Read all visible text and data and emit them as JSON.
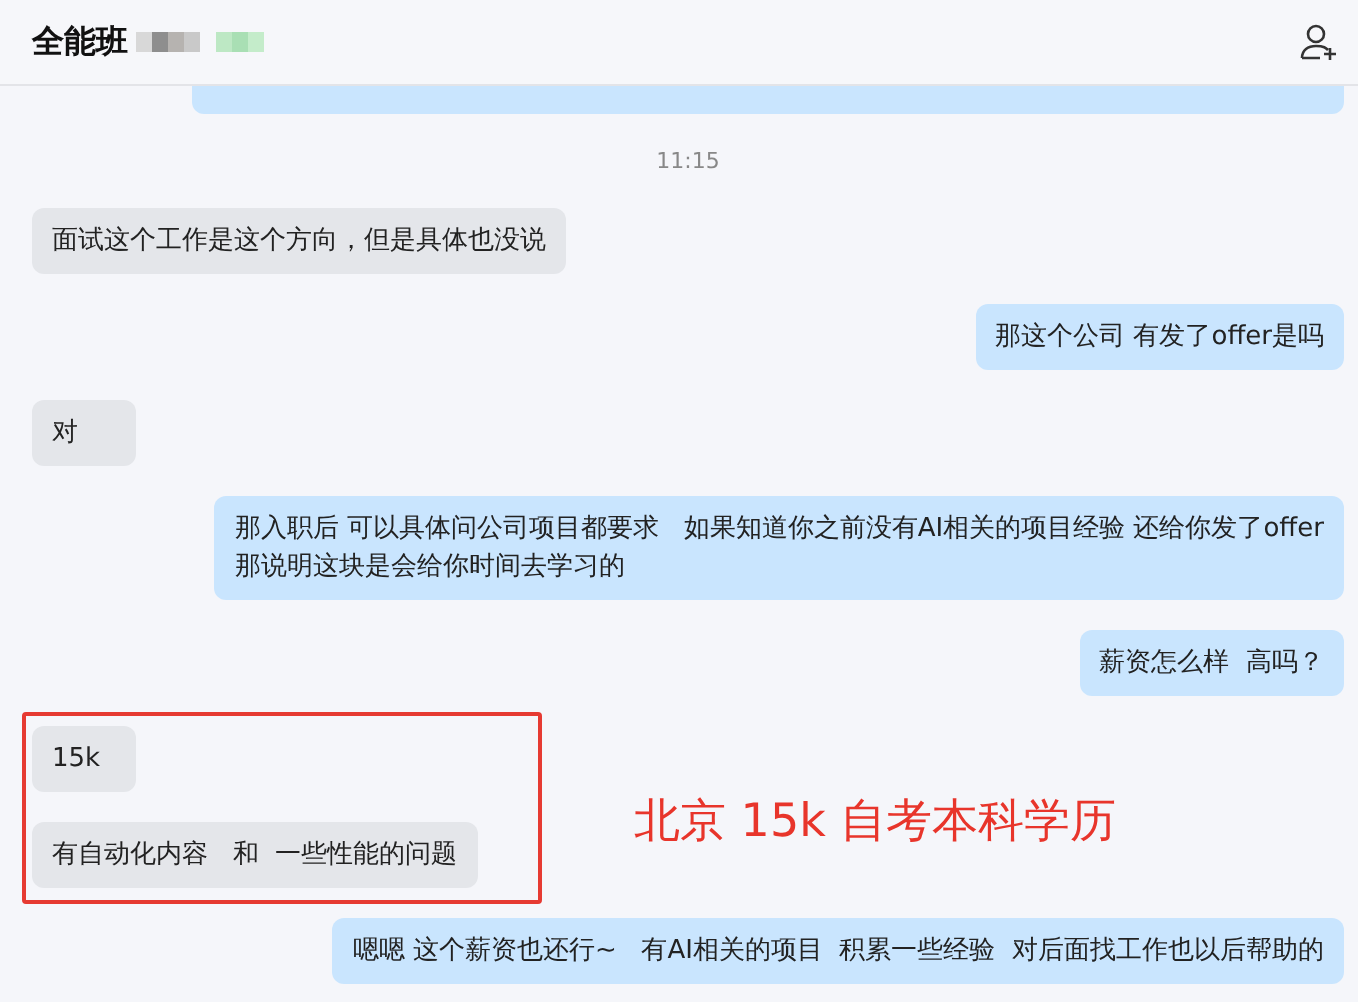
{
  "header": {
    "title": "全能班",
    "name_hidden": true
  },
  "messages": [
    {
      "kind": "partial",
      "outgoing": true
    },
    {
      "kind": "time",
      "text": "11:15"
    },
    {
      "kind": "message",
      "outgoing": false,
      "text": "面试这个工作是这个方向，但是具体也没说"
    },
    {
      "kind": "message",
      "outgoing": true,
      "text": "那这个公司 有发了offer是吗"
    },
    {
      "kind": "message",
      "outgoing": false,
      "text": "对"
    },
    {
      "kind": "message",
      "outgoing": true,
      "lines": [
        "那入职后 可以具体问公司项目都要求   如果知道你之前没有AI相关的项目经验 还给你发了offer",
        "那说明这块是会给你时间去学习的"
      ]
    },
    {
      "kind": "message",
      "outgoing": true,
      "text": "薪资怎么样  高吗？"
    },
    {
      "kind": "highlight",
      "note": "北京 15k 自考本科学历",
      "messages": [
        {
          "outgoing": false,
          "text": "15k"
        },
        {
          "outgoing": false,
          "text": "有自动化内容   和  一些性能的问题"
        }
      ]
    },
    {
      "kind": "message",
      "outgoing": true,
      "text": "嗯嗯 这个薪资也还行~   有AI相关的项目  积累一些经验  对后面找工作也以后帮助的"
    }
  ]
}
